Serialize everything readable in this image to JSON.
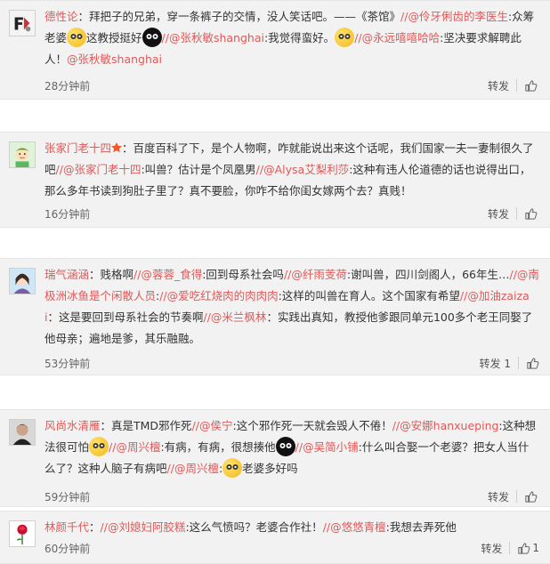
{
  "comments": [
    {
      "name": "德性论",
      "segments": [
        {
          "t": "：拜把子的兄弟，穿一条裤子的交情，没人笑话吧。——《茶馆》"
        },
        {
          "m": "//@伶牙俐齿的李医生"
        },
        {
          "t": ":众筹老婆"
        },
        {
          "e": "yellow"
        },
        {
          "t": "这教授挺好"
        },
        {
          "e": "black"
        },
        {
          "m": "//@张秋敏shanghai"
        },
        {
          "t": ":我觉得蛮好。"
        },
        {
          "e": "yellow"
        },
        {
          "m": "//@永远嘻嘻哈哈"
        },
        {
          "t": ":坚决要求解聘此人！"
        },
        {
          "m": "@张秋敏shanghai"
        }
      ],
      "time": "28分钟前",
      "repost": "转发",
      "likes": ""
    },
    {
      "name": "张家门老十四",
      "segments": [
        {
          "t": "：百度百科了下，是个人物啊，咋就能说出来这个话呢，我们国家一夫一妻制很久了吧"
        },
        {
          "m": "//@张家门老十四"
        },
        {
          "t": ":叫兽？估计是个凤凰男"
        },
        {
          "m": "//@Alysa艾梨利莎"
        },
        {
          "t": ":这种有违人伦道德的话也说得出口，那么多年书读到狗肚子里了？真不要脸，你咋不给你闺女嫁两个去？真贱！"
        }
      ],
      "time": "16分钟前",
      "repost": "转发",
      "likes": ""
    },
    {
      "name": "瑞气涵涵",
      "segments": [
        {
          "t": "：贱格啊"
        },
        {
          "m": "//@蓉蓉_食得"
        },
        {
          "t": ":回到母系社会吗"
        },
        {
          "m": "//@纤雨芰荷"
        },
        {
          "t": ":谢叫兽，四川剑阁人，66年生…"
        },
        {
          "m": "//@南极洲冰鱼是个闲散人员"
        },
        {
          "t": ":"
        },
        {
          "m": "//@爱吃红烧肉的肉肉肉"
        },
        {
          "t": ":这样的叫兽在育人。这个国家有希望"
        },
        {
          "m": "//@加油zaizai"
        },
        {
          "t": "：这是要回到母系社会的节奏啊"
        },
        {
          "m": "//@米兰枫林"
        },
        {
          "t": "：实践出真知，教授他爹跟同单元100多个老王同娶了他母亲；遍地是爹，其乐融融。"
        }
      ],
      "time": "53分钟前",
      "repost": "转发",
      "likes": "1"
    },
    {
      "name": "风尚水清雁",
      "segments": [
        {
          "t": "：真是TMD邪作死"
        },
        {
          "m": "//@侯宁"
        },
        {
          "t": ":这个邪作死一天就会毁人不倦！"
        },
        {
          "m": "//@安娜hanxueping"
        },
        {
          "t": ":这种想法很可怕"
        },
        {
          "e": "yellow"
        },
        {
          "m": "//@周兴檀"
        },
        {
          "t": ":有病，有病，很想揍他"
        },
        {
          "e": "black"
        },
        {
          "m": "//@吴简小铺"
        },
        {
          "t": ":什么叫合娶一个老婆？把女人当什么了？这种人脑子有病吧"
        },
        {
          "m": "//@周兴檀"
        },
        {
          "t": ":"
        },
        {
          "e": "yellow"
        },
        {
          "t": "老婆多好吗"
        }
      ],
      "time": "59分钟前",
      "repost": "转发",
      "likes": ""
    },
    {
      "name": "林颜千代",
      "segments": [
        {
          "t": "："
        },
        {
          "m": "//@刘媳妇阿胶糕"
        },
        {
          "t": ":这么气愤吗？老婆合作社！"
        },
        {
          "m": "//@悠悠青檀"
        },
        {
          "t": ":我想去弄死他"
        }
      ],
      "time": "60分钟前",
      "repost": "转发",
      "likes": "1"
    }
  ],
  "colors": {
    "accent": "#e05858",
    "card_bg": "#f2f2f2"
  }
}
